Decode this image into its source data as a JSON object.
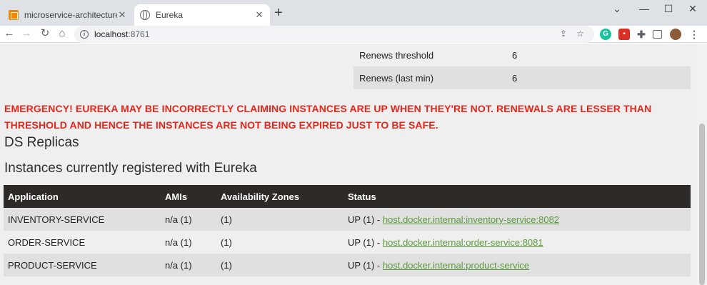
{
  "browser": {
    "tabs": [
      {
        "title": "microservice-architecture.drawio",
        "icon": "drawio-icon",
        "active": false
      },
      {
        "title": "Eureka",
        "icon": "globe-icon",
        "active": true
      }
    ],
    "new_tab": "+",
    "url_host": "localhost",
    "url_port": ":8761"
  },
  "stats": [
    {
      "key": "Renews threshold",
      "value": "6"
    },
    {
      "key": "Renews (last min)",
      "value": "6"
    }
  ],
  "emergency_line1": "EMERGENCY! EUREKA MAY BE INCORRECTLY CLAIMING INSTANCES ARE UP WHEN THEY'RE NOT. RENEWALS ARE LESSER THAN",
  "emergency_line2": "THRESHOLD AND HENCE THE INSTANCES ARE NOT BEING EXPIRED JUST TO BE SAFE.",
  "ds_replicas_heading": "DS Replicas",
  "instances_heading": "Instances currently registered with Eureka",
  "table": {
    "headers": [
      "Application",
      "AMIs",
      "Availability Zones",
      "Status"
    ],
    "rows": [
      {
        "app": "INVENTORY-SERVICE",
        "amis": "n/a (1)",
        "zones": "(1)",
        "status": "UP (1) - ",
        "link": "host.docker.internal:inventory-service:8082"
      },
      {
        "app": "ORDER-SERVICE",
        "amis": "n/a (1)",
        "zones": "(1)",
        "status": "UP (1) - ",
        "link": "host.docker.internal:order-service:8081"
      },
      {
        "app": "PRODUCT-SERVICE",
        "amis": "n/a (1)",
        "zones": "(1)",
        "status": "UP (1) - ",
        "link": "host.docker.internal:product-service"
      }
    ]
  },
  "colors": {
    "emergency": "#e5271b",
    "link": "#5a9a3c",
    "table_header": "#2e2a27"
  }
}
